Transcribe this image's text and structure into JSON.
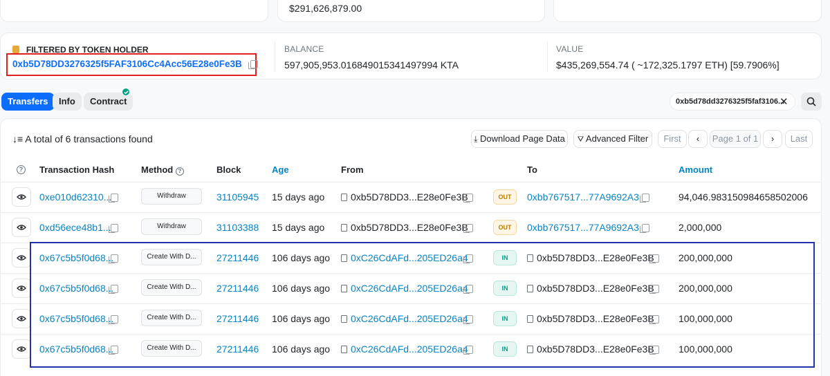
{
  "top": {
    "value_text": "$291,626,879.00"
  },
  "filter": {
    "label": "FILTERED BY TOKEN HOLDER",
    "address": "0xb5D78DD3276325f5FAF3106Cc4Acc56E28e0Fe3B",
    "balance_label": "BALANCE",
    "balance_value": "597,905,953.016849015341497994 KTA",
    "value_label": "VALUE",
    "value_value": "$435,269,554.74 ( ~172,325.1797 ETH) [59.7906%]"
  },
  "tabs": [
    {
      "label": "Transfers"
    },
    {
      "label": "Info"
    },
    {
      "label": "Contract"
    }
  ],
  "search": {
    "value": "0xb5d78dd3276325f5faf3106..."
  },
  "summary": {
    "text": "A total of 6 transactions found"
  },
  "toolbar": {
    "download": "Download Page Data",
    "filter": "Advanced Filter",
    "first": "First",
    "page": "Page 1 of 1",
    "last": "Last"
  },
  "table": {
    "headers": {
      "hash": "Transaction Hash",
      "method": "Method",
      "block": "Block",
      "age": "Age",
      "from": "From",
      "to": "To",
      "amount": "Amount"
    },
    "rows": [
      {
        "hash": "0xe010d62310...",
        "method": "Withdraw",
        "block": "31105945",
        "age": "15 days ago",
        "from": "0xb5D78DD3...E28e0Fe3B",
        "dir": "OUT",
        "to": "0xbb767517...77A9692A3",
        "amount": "94,046.983150984658502006"
      },
      {
        "hash": "0xd56ece48b1...",
        "method": "Withdraw",
        "block": "31103388",
        "age": "15 days ago",
        "from": "0xb5D78DD3...E28e0Fe3B",
        "dir": "OUT",
        "to": "0xbb767517...77A9692A3",
        "amount": "2,000,000"
      },
      {
        "hash": "0x67c5b5f0d68...",
        "method": "Create With D...",
        "block": "27211446",
        "age": "106 days ago",
        "from": "0xC26CdAFd...205ED26a4",
        "dir": "IN",
        "to": "0xb5D78DD3...E28e0Fe3B",
        "amount": "200,000,000"
      },
      {
        "hash": "0x67c5b5f0d68...",
        "method": "Create With D...",
        "block": "27211446",
        "age": "106 days ago",
        "from": "0xC26CdAFd...205ED26a4",
        "dir": "IN",
        "to": "0xb5D78DD3...E28e0Fe3B",
        "amount": "200,000,000"
      },
      {
        "hash": "0x67c5b5f0d68...",
        "method": "Create With D...",
        "block": "27211446",
        "age": "106 days ago",
        "from": "0xC26CdAFd...205ED26a4",
        "dir": "IN",
        "to": "0xb5D78DD3...E28e0Fe3B",
        "amount": "100,000,000"
      },
      {
        "hash": "0x67c5b5f0d68...",
        "method": "Create With D...",
        "block": "27211446",
        "age": "106 days ago",
        "from": "0xC26CdAFd...205ED26a4",
        "dir": "IN",
        "to": "0xb5D78DD3...E28e0Fe3B",
        "amount": "100,000,000"
      }
    ]
  },
  "colors": {
    "accent": "#0784c3",
    "primary": "#0d6efd",
    "highlight_red": "#e02020",
    "highlight_blue": "#2233aa"
  }
}
